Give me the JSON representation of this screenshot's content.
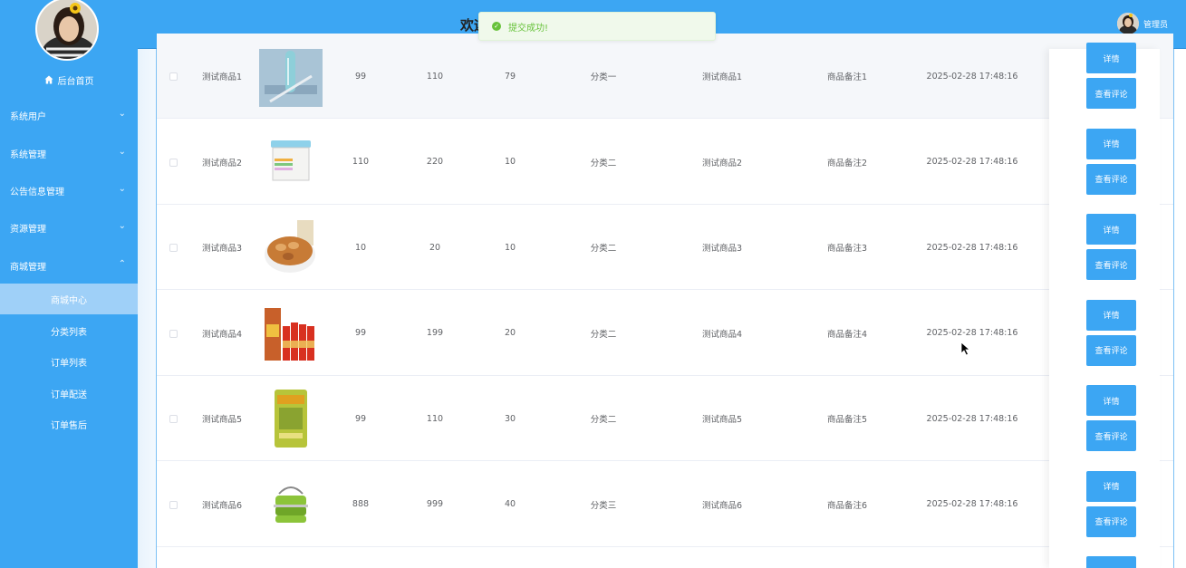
{
  "sidebar": {
    "home": "后台首页",
    "menus": [
      {
        "label": "系统用户",
        "chevron": "⌄"
      },
      {
        "label": "系统管理",
        "chevron": "⌄"
      },
      {
        "label": "公告信息管理",
        "chevron": "⌄"
      },
      {
        "label": "资源管理",
        "chevron": "⌄"
      },
      {
        "label": "商城管理",
        "chevron": "⌃"
      }
    ],
    "submenus": [
      "商城中心",
      "分类列表",
      "订单列表",
      "订单配送",
      "订单售后"
    ]
  },
  "header": {
    "title": "欢迎",
    "user": "管理员"
  },
  "toast": {
    "message": "提交成功!"
  },
  "table": {
    "rows": [
      {
        "name": "测试商品1",
        "c1": "99",
        "c2": "110",
        "c3": "79",
        "category": "分类一",
        "desc": "测试商品1",
        "note": "商品备注1",
        "time": "2025-02-28 17:48:16",
        "image": "bottle"
      },
      {
        "name": "测试商品2",
        "c1": "110",
        "c2": "220",
        "c3": "10",
        "category": "分类二",
        "desc": "测试商品2",
        "note": "商品备注2",
        "time": "2025-02-28 17:48:16",
        "image": "container"
      },
      {
        "name": "测试商品3",
        "c1": "10",
        "c2": "20",
        "c3": "10",
        "category": "分类二",
        "desc": "测试商品3",
        "note": "商品备注3",
        "time": "2025-02-28 17:48:16",
        "image": "nuts"
      },
      {
        "name": "测试商品4",
        "c1": "99",
        "c2": "199",
        "c3": "20",
        "category": "分类二",
        "desc": "测试商品4",
        "note": "商品备注4",
        "time": "2025-02-28 17:48:16",
        "image": "liquor"
      },
      {
        "name": "测试商品5",
        "c1": "99",
        "c2": "110",
        "c3": "30",
        "category": "分类二",
        "desc": "测试商品5",
        "note": "商品备注5",
        "time": "2025-02-28 17:48:16",
        "image": "rice-bag"
      },
      {
        "name": "测试商品6",
        "c1": "888",
        "c2": "999",
        "c3": "40",
        "category": "分类三",
        "desc": "测试商品6",
        "note": "商品备注6",
        "time": "2025-02-28 17:48:16",
        "image": "lunchbox"
      }
    ],
    "detail_label": "详情",
    "review_label": "查看评论"
  }
}
